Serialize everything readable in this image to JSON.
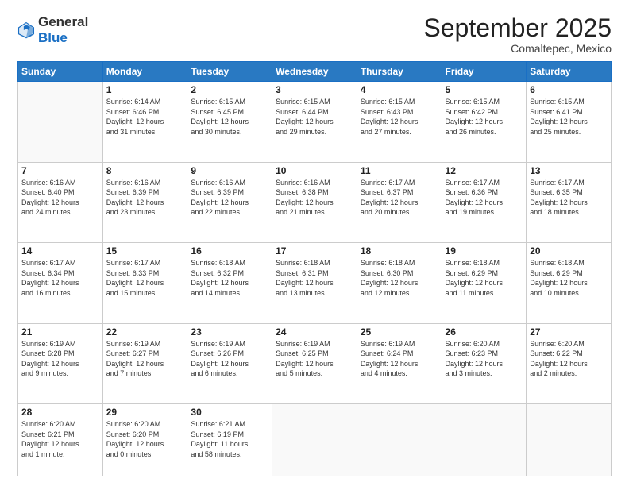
{
  "logo": {
    "general": "General",
    "blue": "Blue"
  },
  "header": {
    "month": "September 2025",
    "location": "Comaltepec, Mexico"
  },
  "weekdays": [
    "Sunday",
    "Monday",
    "Tuesday",
    "Wednesday",
    "Thursday",
    "Friday",
    "Saturday"
  ],
  "weeks": [
    [
      {
        "day": "",
        "info": ""
      },
      {
        "day": "1",
        "info": "Sunrise: 6:14 AM\nSunset: 6:46 PM\nDaylight: 12 hours\nand 31 minutes."
      },
      {
        "day": "2",
        "info": "Sunrise: 6:15 AM\nSunset: 6:45 PM\nDaylight: 12 hours\nand 30 minutes."
      },
      {
        "day": "3",
        "info": "Sunrise: 6:15 AM\nSunset: 6:44 PM\nDaylight: 12 hours\nand 29 minutes."
      },
      {
        "day": "4",
        "info": "Sunrise: 6:15 AM\nSunset: 6:43 PM\nDaylight: 12 hours\nand 27 minutes."
      },
      {
        "day": "5",
        "info": "Sunrise: 6:15 AM\nSunset: 6:42 PM\nDaylight: 12 hours\nand 26 minutes."
      },
      {
        "day": "6",
        "info": "Sunrise: 6:15 AM\nSunset: 6:41 PM\nDaylight: 12 hours\nand 25 minutes."
      }
    ],
    [
      {
        "day": "7",
        "info": "Sunrise: 6:16 AM\nSunset: 6:40 PM\nDaylight: 12 hours\nand 24 minutes."
      },
      {
        "day": "8",
        "info": "Sunrise: 6:16 AM\nSunset: 6:39 PM\nDaylight: 12 hours\nand 23 minutes."
      },
      {
        "day": "9",
        "info": "Sunrise: 6:16 AM\nSunset: 6:39 PM\nDaylight: 12 hours\nand 22 minutes."
      },
      {
        "day": "10",
        "info": "Sunrise: 6:16 AM\nSunset: 6:38 PM\nDaylight: 12 hours\nand 21 minutes."
      },
      {
        "day": "11",
        "info": "Sunrise: 6:17 AM\nSunset: 6:37 PM\nDaylight: 12 hours\nand 20 minutes."
      },
      {
        "day": "12",
        "info": "Sunrise: 6:17 AM\nSunset: 6:36 PM\nDaylight: 12 hours\nand 19 minutes."
      },
      {
        "day": "13",
        "info": "Sunrise: 6:17 AM\nSunset: 6:35 PM\nDaylight: 12 hours\nand 18 minutes."
      }
    ],
    [
      {
        "day": "14",
        "info": "Sunrise: 6:17 AM\nSunset: 6:34 PM\nDaylight: 12 hours\nand 16 minutes."
      },
      {
        "day": "15",
        "info": "Sunrise: 6:17 AM\nSunset: 6:33 PM\nDaylight: 12 hours\nand 15 minutes."
      },
      {
        "day": "16",
        "info": "Sunrise: 6:18 AM\nSunset: 6:32 PM\nDaylight: 12 hours\nand 14 minutes."
      },
      {
        "day": "17",
        "info": "Sunrise: 6:18 AM\nSunset: 6:31 PM\nDaylight: 12 hours\nand 13 minutes."
      },
      {
        "day": "18",
        "info": "Sunrise: 6:18 AM\nSunset: 6:30 PM\nDaylight: 12 hours\nand 12 minutes."
      },
      {
        "day": "19",
        "info": "Sunrise: 6:18 AM\nSunset: 6:29 PM\nDaylight: 12 hours\nand 11 minutes."
      },
      {
        "day": "20",
        "info": "Sunrise: 6:18 AM\nSunset: 6:29 PM\nDaylight: 12 hours\nand 10 minutes."
      }
    ],
    [
      {
        "day": "21",
        "info": "Sunrise: 6:19 AM\nSunset: 6:28 PM\nDaylight: 12 hours\nand 9 minutes."
      },
      {
        "day": "22",
        "info": "Sunrise: 6:19 AM\nSunset: 6:27 PM\nDaylight: 12 hours\nand 7 minutes."
      },
      {
        "day": "23",
        "info": "Sunrise: 6:19 AM\nSunset: 6:26 PM\nDaylight: 12 hours\nand 6 minutes."
      },
      {
        "day": "24",
        "info": "Sunrise: 6:19 AM\nSunset: 6:25 PM\nDaylight: 12 hours\nand 5 minutes."
      },
      {
        "day": "25",
        "info": "Sunrise: 6:19 AM\nSunset: 6:24 PM\nDaylight: 12 hours\nand 4 minutes."
      },
      {
        "day": "26",
        "info": "Sunrise: 6:20 AM\nSunset: 6:23 PM\nDaylight: 12 hours\nand 3 minutes."
      },
      {
        "day": "27",
        "info": "Sunrise: 6:20 AM\nSunset: 6:22 PM\nDaylight: 12 hours\nand 2 minutes."
      }
    ],
    [
      {
        "day": "28",
        "info": "Sunrise: 6:20 AM\nSunset: 6:21 PM\nDaylight: 12 hours\nand 1 minute."
      },
      {
        "day": "29",
        "info": "Sunrise: 6:20 AM\nSunset: 6:20 PM\nDaylight: 12 hours\nand 0 minutes."
      },
      {
        "day": "30",
        "info": "Sunrise: 6:21 AM\nSunset: 6:19 PM\nDaylight: 11 hours\nand 58 minutes."
      },
      {
        "day": "",
        "info": ""
      },
      {
        "day": "",
        "info": ""
      },
      {
        "day": "",
        "info": ""
      },
      {
        "day": "",
        "info": ""
      }
    ]
  ]
}
